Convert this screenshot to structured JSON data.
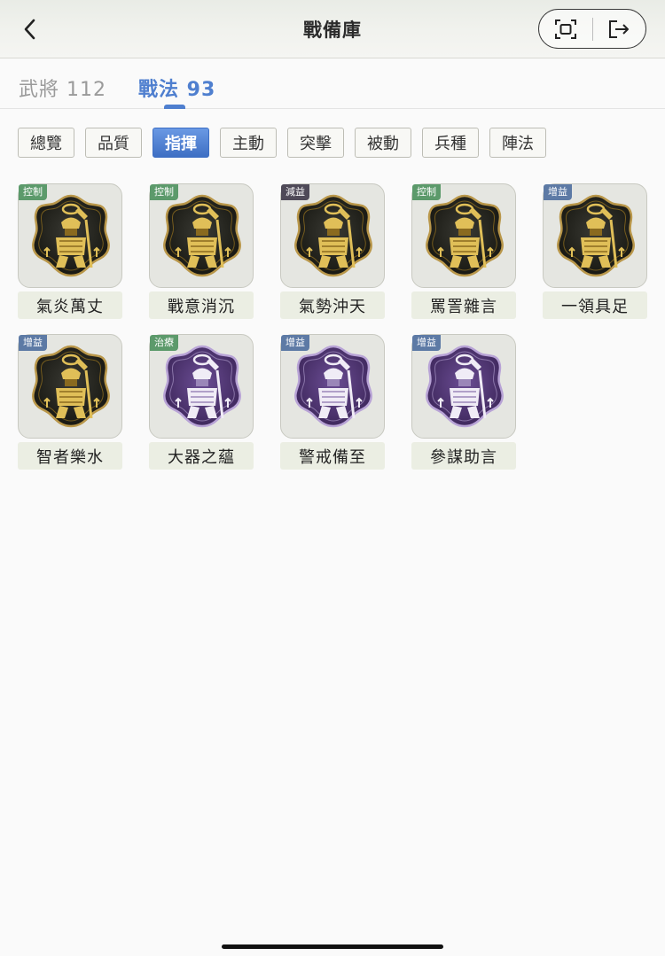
{
  "header": {
    "title": "戰備庫"
  },
  "tabs": [
    {
      "label": "武將 112"
    },
    {
      "label": "戰法 93"
    }
  ],
  "filters": [
    "總覽",
    "品質",
    "指揮",
    "主動",
    "突擊",
    "被動",
    "兵種",
    "陣法"
  ],
  "active_filter": "指揮",
  "skills": [
    {
      "name": "氣炎萬丈",
      "tag": "控制",
      "tag_color": "#5c9a6b",
      "tier": "gold"
    },
    {
      "name": "戰意消沉",
      "tag": "控制",
      "tag_color": "#5c9a6b",
      "tier": "gold"
    },
    {
      "name": "氣勢沖天",
      "tag": "減益",
      "tag_color": "#4f4a58",
      "tier": "gold"
    },
    {
      "name": "罵詈雜言",
      "tag": "控制",
      "tag_color": "#5c9a6b",
      "tier": "gold"
    },
    {
      "name": "一領具足",
      "tag": "增益",
      "tag_color": "#5d7aa5",
      "tier": "gold"
    },
    {
      "name": "智者樂水",
      "tag": "增益",
      "tag_color": "#5d7aa5",
      "tier": "gold"
    },
    {
      "name": "大器之蘊",
      "tag": "治療",
      "tag_color": "#5c9a6b",
      "tier": "purple"
    },
    {
      "name": "警戒備至",
      "tag": "增益",
      "tag_color": "#5d7aa5",
      "tier": "purple"
    },
    {
      "name": "參謀助言",
      "tag": "增益",
      "tag_color": "#5d7aa5",
      "tier": "purple"
    }
  ],
  "icons": {
    "back": "chevron-left-icon",
    "screenshot": "screenshot-frame-icon",
    "exit": "exit-icon"
  },
  "colors": {
    "accent": "#4f7fcf",
    "gold": "#c9a53a",
    "purple": "#5a3f7e"
  }
}
